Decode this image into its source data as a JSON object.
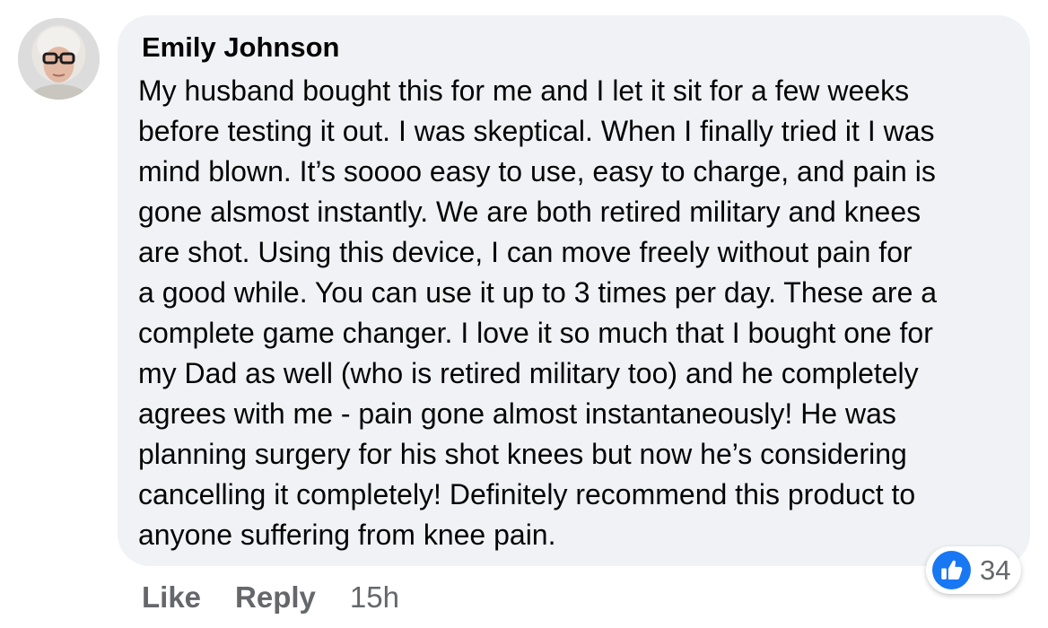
{
  "comment": {
    "author": "Emily Johnson",
    "text_lines": [
      "My husband bought this for me and I let it sit for a few weeks",
      "before testing it out. I was skeptical. When I finally tried it I was",
      "mind blown. It’s soooo easy to use, easy to charge, and pain is",
      "gone alsmost instantly. We are both retired military and knees",
      "are shot. Using this device, I can move freely without pain for",
      "a good while. You can use it up to 3 times per day. These are a",
      "complete game changer. I love it so much that I bought one for",
      "my Dad as well (who is retired military too) and he completely",
      "agrees with me - pain gone almost instantaneously! He was",
      "planning surgery for his shot knees but now he’s considering",
      "cancelling it completely! Definitely recommend this product to",
      "anyone suffering from knee pain."
    ],
    "reactions": {
      "icon": "like-thumbs-up-icon",
      "count": "34"
    },
    "actions": {
      "like_label": "Like",
      "reply_label": "Reply",
      "timestamp": "15h"
    }
  },
  "colors": {
    "bubble_background": "#f0f2f5",
    "secondary_text": "#65676b",
    "like_blue": "#1877f2",
    "primary_text": "#050505"
  }
}
